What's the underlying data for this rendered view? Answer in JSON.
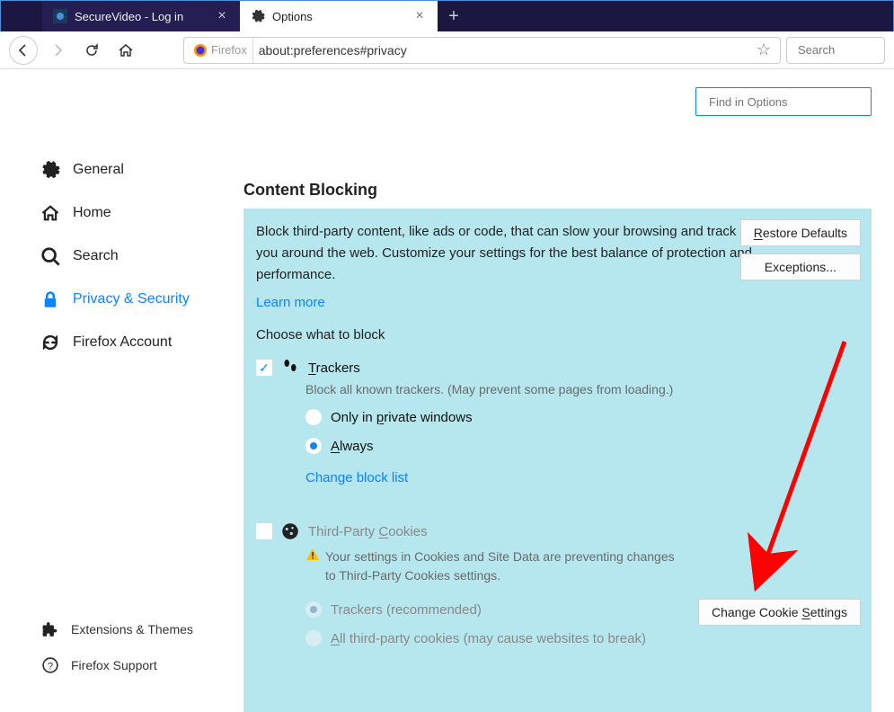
{
  "tabs": {
    "inactive_title": "SecureVideo - Log in",
    "active_title": "Options"
  },
  "urlbar": {
    "identity": "Firefox",
    "url": "about:preferences#privacy"
  },
  "searchbar_placeholder": "Search",
  "find_placeholder": "Find in Options",
  "sidebar": {
    "general": "General",
    "home": "Home",
    "search": "Search",
    "privacy": "Privacy & Security",
    "account": "Firefox Account",
    "extensions": "Extensions & Themes",
    "support": "Firefox Support"
  },
  "section": {
    "title": "Content Blocking",
    "desc": "Block third-party content, like ads or code, that can slow your browsing and track you around the web. Customize your settings for the best balance of protection and performance.",
    "learn_more": "Learn more",
    "restore": "Restore Defaults",
    "exceptions": "Exceptions...",
    "choose": "Choose what to block",
    "trackers": {
      "label_pre": "T",
      "label_post": "rackers",
      "desc": "Block all known trackers. (May prevent some pages from loading.)",
      "only_pre": "Only in ",
      "only_u": "p",
      "only_post": "rivate windows",
      "always_u": "A",
      "always_post": "lways",
      "change_list": "Change block list"
    },
    "cookies": {
      "label_pre": "Third-Party ",
      "label_u": "C",
      "label_post": "ookies",
      "warn": "Your settings in Cookies and Site Data are preventing changes to Third-Party Cookies settings.",
      "opt1": "Trackers (recommended)",
      "opt2_u": "A",
      "opt2_post": "ll third-party cookies (may cause websites to break)",
      "change_btn_pre": "Change Cookie ",
      "change_btn_u": "S",
      "change_btn_post": "ettings"
    }
  }
}
